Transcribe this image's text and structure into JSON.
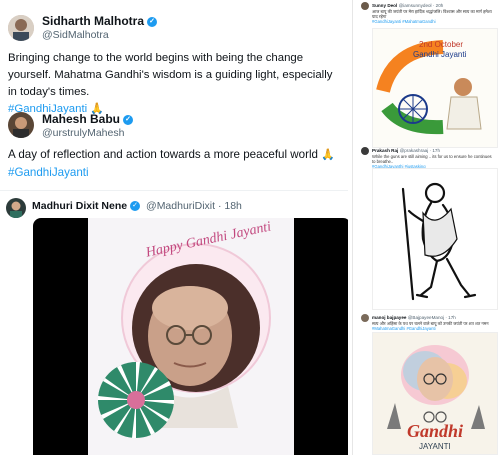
{
  "tweets": [
    {
      "name": "Sidharth Malhotra",
      "handle": "@SidMalhotra",
      "text": "Bringing change to the world begins with being the change yourself. Mahatma Gandhi's wisdom is a guiding light, especially in today's times.",
      "hashtag": "#GandhiJayanti",
      "emoji": "🙏"
    },
    {
      "name": "Mahesh Babu",
      "handle": "@urstrulyMahesh",
      "text": "A day of reflection and action towards a more peaceful world",
      "hashtag": "#GandhiJayanti",
      "emoji": "🙏"
    },
    {
      "name": "Madhuri Dixit Nene",
      "handle": "@MadhuriDixit",
      "time": "· 18h",
      "image_text": "Happy Gandhi Jayanti"
    }
  ],
  "right_posts": [
    {
      "name": "Sunny Deol",
      "meta": "@iamsunnydeol · 20h",
      "text": "आज बापू की जयंती पर मेरा हार्दिक श्रद्धांजलि। विश्वास और सत्य का मार्ग हमेशा याद रहेगा",
      "hashtag": "#GandhiJayanti #MahatmaGandhi",
      "image_line1": "2nd October",
      "image_line2": "Gandhi Jayanti"
    },
    {
      "name": "Prakash Raj",
      "meta": "@prakashraaj · 17h",
      "text": "While the guns are still aiming .. its for us to ensure he continues to breathe..",
      "hashtag": "#GandhiJayanthi #justasking"
    },
    {
      "name": "manoj bajpayee",
      "meta": "@BajpayeeManoj · 17h",
      "text": "सत्य और अहिंसा के पथ पर चलने वाले बापू को उनकी जयंती पर शत शत नमन",
      "hashtag": "#MahatmaGandhi #GandhiJayanti",
      "image_line1": "Gandhi",
      "image_line2": "JAYANTI"
    }
  ],
  "colors": {
    "link": "#1d9bf0",
    "verified": "#1d9bf0",
    "saffron": "#f58220",
    "green": "#3a9a3a",
    "pink": "#d86f9a"
  }
}
